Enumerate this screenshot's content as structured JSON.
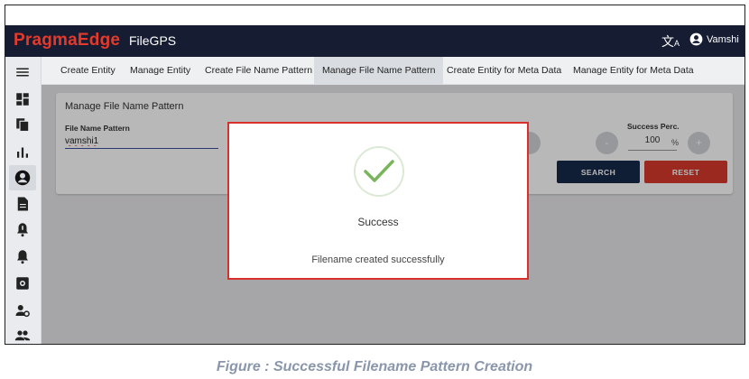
{
  "header": {
    "logo_text": "PragmaEdge",
    "product": "FileGPS",
    "translate_icon": "translate-icon",
    "user_name": "Vamshi",
    "user_icon": "account-circle-icon"
  },
  "sidebar": {
    "items": [
      {
        "icon": "menu-icon"
      },
      {
        "icon": "dashboard-icon"
      },
      {
        "icon": "copy-icon"
      },
      {
        "icon": "bar-chart-icon"
      },
      {
        "icon": "account-circle-icon",
        "active": true
      },
      {
        "icon": "document-icon"
      },
      {
        "icon": "bell-alert-icon"
      },
      {
        "icon": "bell-icon"
      },
      {
        "icon": "settings-box-icon"
      },
      {
        "icon": "user-settings-icon"
      },
      {
        "icon": "group-icon"
      }
    ]
  },
  "tabs": [
    {
      "label": "Create Entity"
    },
    {
      "label": "Manage Entity"
    },
    {
      "label": "Create File Name Pattern"
    },
    {
      "label": "Manage File Name Pattern",
      "active": true
    },
    {
      "label": "Create Entity for Meta Data"
    },
    {
      "label": "Manage Entity for Meta Data"
    }
  ],
  "form": {
    "title": "Manage File Name Pattern",
    "file_name_label": "File Name Pattern",
    "file_name_value": "vamshi1",
    "success_label": "Success Perc.",
    "success_value": "100",
    "success_unit": "%",
    "minus_label": "-",
    "plus_label": "+",
    "search_label": "SEARCH",
    "reset_label": "RESET"
  },
  "dialog": {
    "icon": "check-circle-icon",
    "title": "Success",
    "message": "Filename created successfully"
  },
  "caption": "Figure : Successful Filename Pattern Creation",
  "colors": {
    "appbar": "#161d33",
    "brand": "#e33a2b",
    "search": "#15294a",
    "reset": "#d9392c",
    "dialog_border": "#d8302c",
    "check": "#7ab55c"
  }
}
